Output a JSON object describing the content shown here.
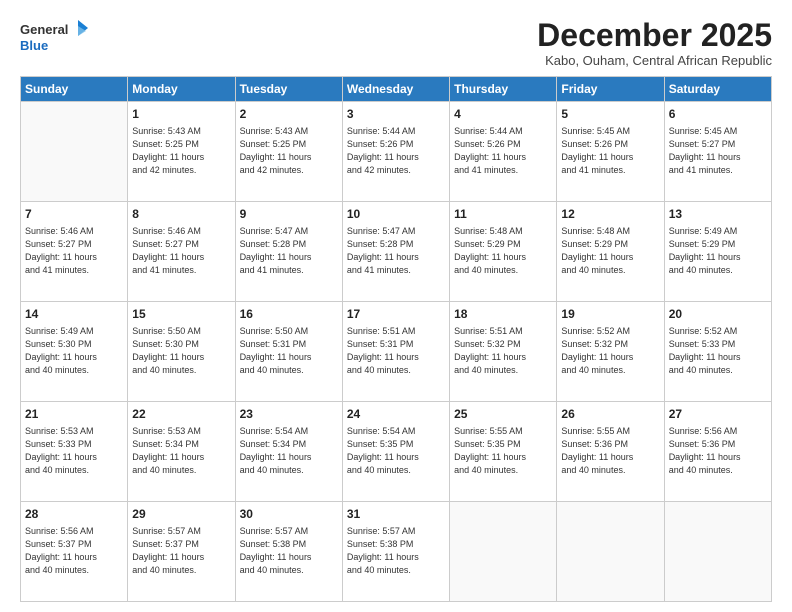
{
  "logo": {
    "line1": "General",
    "line2": "Blue"
  },
  "title": "December 2025",
  "subtitle": "Kabo, Ouham, Central African Republic",
  "header_days": [
    "Sunday",
    "Monday",
    "Tuesday",
    "Wednesday",
    "Thursday",
    "Friday",
    "Saturday"
  ],
  "weeks": [
    [
      {
        "day": "",
        "info": ""
      },
      {
        "day": "1",
        "info": "Sunrise: 5:43 AM\nSunset: 5:25 PM\nDaylight: 11 hours\nand 42 minutes."
      },
      {
        "day": "2",
        "info": "Sunrise: 5:43 AM\nSunset: 5:25 PM\nDaylight: 11 hours\nand 42 minutes."
      },
      {
        "day": "3",
        "info": "Sunrise: 5:44 AM\nSunset: 5:26 PM\nDaylight: 11 hours\nand 42 minutes."
      },
      {
        "day": "4",
        "info": "Sunrise: 5:44 AM\nSunset: 5:26 PM\nDaylight: 11 hours\nand 41 minutes."
      },
      {
        "day": "5",
        "info": "Sunrise: 5:45 AM\nSunset: 5:26 PM\nDaylight: 11 hours\nand 41 minutes."
      },
      {
        "day": "6",
        "info": "Sunrise: 5:45 AM\nSunset: 5:27 PM\nDaylight: 11 hours\nand 41 minutes."
      }
    ],
    [
      {
        "day": "7",
        "info": "Sunrise: 5:46 AM\nSunset: 5:27 PM\nDaylight: 11 hours\nand 41 minutes."
      },
      {
        "day": "8",
        "info": "Sunrise: 5:46 AM\nSunset: 5:27 PM\nDaylight: 11 hours\nand 41 minutes."
      },
      {
        "day": "9",
        "info": "Sunrise: 5:47 AM\nSunset: 5:28 PM\nDaylight: 11 hours\nand 41 minutes."
      },
      {
        "day": "10",
        "info": "Sunrise: 5:47 AM\nSunset: 5:28 PM\nDaylight: 11 hours\nand 41 minutes."
      },
      {
        "day": "11",
        "info": "Sunrise: 5:48 AM\nSunset: 5:29 PM\nDaylight: 11 hours\nand 40 minutes."
      },
      {
        "day": "12",
        "info": "Sunrise: 5:48 AM\nSunset: 5:29 PM\nDaylight: 11 hours\nand 40 minutes."
      },
      {
        "day": "13",
        "info": "Sunrise: 5:49 AM\nSunset: 5:29 PM\nDaylight: 11 hours\nand 40 minutes."
      }
    ],
    [
      {
        "day": "14",
        "info": "Sunrise: 5:49 AM\nSunset: 5:30 PM\nDaylight: 11 hours\nand 40 minutes."
      },
      {
        "day": "15",
        "info": "Sunrise: 5:50 AM\nSunset: 5:30 PM\nDaylight: 11 hours\nand 40 minutes."
      },
      {
        "day": "16",
        "info": "Sunrise: 5:50 AM\nSunset: 5:31 PM\nDaylight: 11 hours\nand 40 minutes."
      },
      {
        "day": "17",
        "info": "Sunrise: 5:51 AM\nSunset: 5:31 PM\nDaylight: 11 hours\nand 40 minutes."
      },
      {
        "day": "18",
        "info": "Sunrise: 5:51 AM\nSunset: 5:32 PM\nDaylight: 11 hours\nand 40 minutes."
      },
      {
        "day": "19",
        "info": "Sunrise: 5:52 AM\nSunset: 5:32 PM\nDaylight: 11 hours\nand 40 minutes."
      },
      {
        "day": "20",
        "info": "Sunrise: 5:52 AM\nSunset: 5:33 PM\nDaylight: 11 hours\nand 40 minutes."
      }
    ],
    [
      {
        "day": "21",
        "info": "Sunrise: 5:53 AM\nSunset: 5:33 PM\nDaylight: 11 hours\nand 40 minutes."
      },
      {
        "day": "22",
        "info": "Sunrise: 5:53 AM\nSunset: 5:34 PM\nDaylight: 11 hours\nand 40 minutes."
      },
      {
        "day": "23",
        "info": "Sunrise: 5:54 AM\nSunset: 5:34 PM\nDaylight: 11 hours\nand 40 minutes."
      },
      {
        "day": "24",
        "info": "Sunrise: 5:54 AM\nSunset: 5:35 PM\nDaylight: 11 hours\nand 40 minutes."
      },
      {
        "day": "25",
        "info": "Sunrise: 5:55 AM\nSunset: 5:35 PM\nDaylight: 11 hours\nand 40 minutes."
      },
      {
        "day": "26",
        "info": "Sunrise: 5:55 AM\nSunset: 5:36 PM\nDaylight: 11 hours\nand 40 minutes."
      },
      {
        "day": "27",
        "info": "Sunrise: 5:56 AM\nSunset: 5:36 PM\nDaylight: 11 hours\nand 40 minutes."
      }
    ],
    [
      {
        "day": "28",
        "info": "Sunrise: 5:56 AM\nSunset: 5:37 PM\nDaylight: 11 hours\nand 40 minutes."
      },
      {
        "day": "29",
        "info": "Sunrise: 5:57 AM\nSunset: 5:37 PM\nDaylight: 11 hours\nand 40 minutes."
      },
      {
        "day": "30",
        "info": "Sunrise: 5:57 AM\nSunset: 5:38 PM\nDaylight: 11 hours\nand 40 minutes."
      },
      {
        "day": "31",
        "info": "Sunrise: 5:57 AM\nSunset: 5:38 PM\nDaylight: 11 hours\nand 40 minutes."
      },
      {
        "day": "",
        "info": ""
      },
      {
        "day": "",
        "info": ""
      },
      {
        "day": "",
        "info": ""
      }
    ]
  ]
}
